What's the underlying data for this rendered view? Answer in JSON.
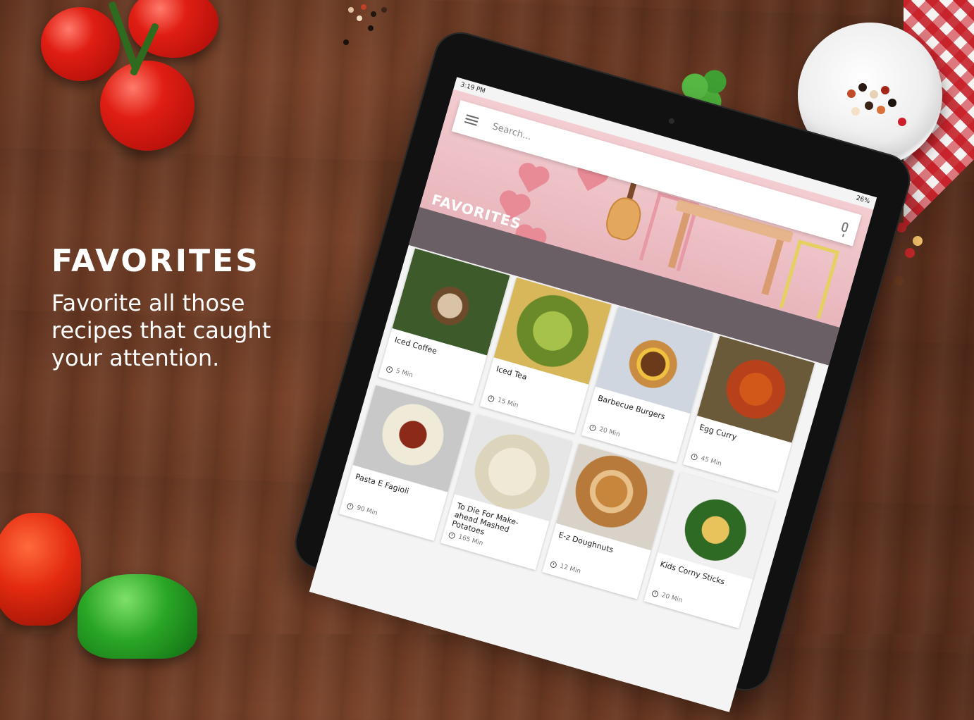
{
  "promo": {
    "title": "FAVORITES",
    "subtitle": "Favorite all those recipes that caught your attention."
  },
  "device": {
    "status_time": "3:19 PM",
    "battery": "26%"
  },
  "search": {
    "placeholder": "Search..."
  },
  "hero": {
    "title": "FAVORITES"
  },
  "recipes": [
    {
      "title": "Iced Coffee",
      "time": "5 Min"
    },
    {
      "title": "Iced Tea",
      "time": "15 Min"
    },
    {
      "title": "Barbecue Burgers",
      "time": "20 Min"
    },
    {
      "title": "Egg Curry",
      "time": "45 Min"
    },
    {
      "title": "Pasta E Fagioli",
      "time": "90 Min"
    },
    {
      "title": "To Die For Make-ahead Mashed Potatoes",
      "time": "165 Min"
    },
    {
      "title": "E-z Doughnuts",
      "time": "12 Min"
    },
    {
      "title": "Kids Corny Sticks",
      "time": "20 Min"
    }
  ],
  "colors": {
    "accent_pink": "#e8b6bc",
    "heart": "#e88b96",
    "wood": "#6b3a24"
  }
}
